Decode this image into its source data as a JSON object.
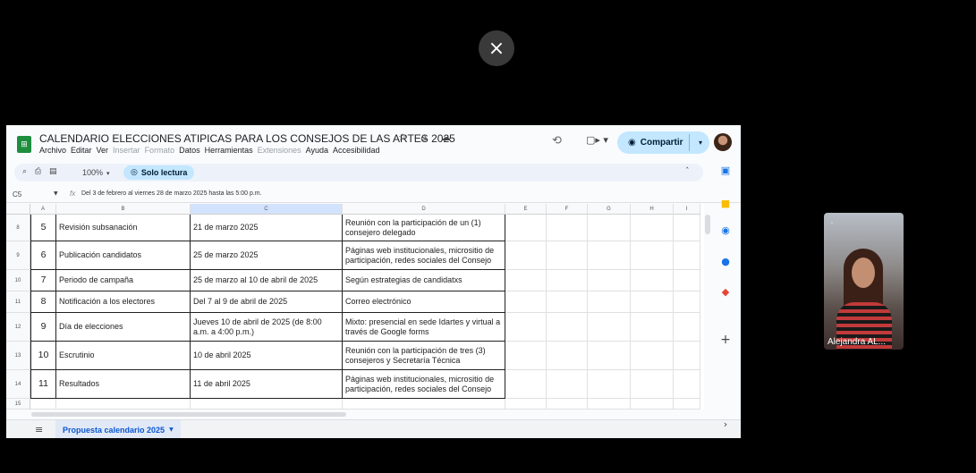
{
  "overlay": {
    "close_glyph": "×"
  },
  "document": {
    "title": "CALENDARIO ELECCIONES ATIPICAS PARA LOS CONSEJOS DE LAS ARTES 2025",
    "title_icons": "☆ ⌂ ☁",
    "menu": [
      {
        "label": "Archivo",
        "enabled": true
      },
      {
        "label": "Editar",
        "enabled": true
      },
      {
        "label": "Ver",
        "enabled": true
      },
      {
        "label": "Insertar",
        "enabled": false
      },
      {
        "label": "Formato",
        "enabled": false
      },
      {
        "label": "Datos",
        "enabled": true
      },
      {
        "label": "Herramientas",
        "enabled": true
      },
      {
        "label": "Extensiones",
        "enabled": false
      },
      {
        "label": "Ayuda",
        "enabled": true
      },
      {
        "label": "Accesibilidad",
        "enabled": true
      }
    ],
    "share_label": "Compartir"
  },
  "toolbar": {
    "icons": "⌕ ⎙ ▤",
    "zoom": "100%",
    "readonly_label": "Solo lectura"
  },
  "formula_bar": {
    "cell_ref": "C5",
    "fx": "fx",
    "content": "Del 3 de febrero al viernes 28 de marzo 2025 hasta las 5:00 p.m."
  },
  "grid": {
    "columns": [
      "A",
      "B",
      "C",
      "D",
      "E",
      "F",
      "G",
      "H",
      "I"
    ],
    "rows": [
      {
        "row": "8",
        "num": "5",
        "activity": "Revisión subsanación",
        "date": "21 de marzo 2025",
        "detail": "Reunión con la participación de un (1) consejero delegado"
      },
      {
        "row": "9",
        "num": "6",
        "activity": "Publicación candidatos",
        "date": "25 de marzo 2025",
        "detail": "Páginas web institucionales, micrositio de participación, redes sociales del Consejo"
      },
      {
        "row": "10",
        "num": "7",
        "activity": "Periodo de campaña",
        "date": "25 de marzo al 10 de abril de 2025",
        "detail": "Según estrategias de candidatxs"
      },
      {
        "row": "11",
        "num": "8",
        "activity": "Notificación a los electores",
        "date": "Del 7 al 9 de abril de 2025",
        "detail": "Correo electrónico"
      },
      {
        "row": "12",
        "num": "9",
        "activity": "Día de elecciones",
        "date": "Jueves 10 de abril de 2025 (de 8:00 a.m. a 4:00 p.m.)",
        "detail": "Mixto: presencial en sede Idartes y virtual a través de Google forms"
      },
      {
        "row": "13",
        "num": "10",
        "activity": "Escrutinio",
        "date": "10 de abril 2025",
        "detail": "Reunión con la participación de tres (3) consejeros y Secretaría Técnica"
      },
      {
        "row": "14",
        "num": "11",
        "activity": "Resultados",
        "date": "11 de abril 2025",
        "detail": "Páginas web institucionales, micrositio de participación, redes sociales del Consejo"
      },
      {
        "row": "15",
        "num": "",
        "activity": "",
        "date": "",
        "detail": ""
      }
    ]
  },
  "sheet_tabs": {
    "active": "Propuesta calendario 2025"
  },
  "video": {
    "participant_name": "Alejandra AL..."
  }
}
